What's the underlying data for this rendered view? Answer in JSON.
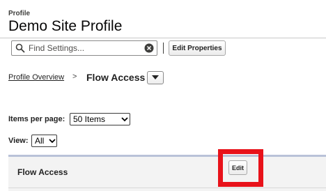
{
  "header": {
    "eyebrow": "Profile",
    "title": "Demo Site Profile"
  },
  "toolbar": {
    "search_placeholder": "Find Settings...",
    "edit_properties_label": "Edit Properties"
  },
  "breadcrumb": {
    "parent_label": "Profile Overview",
    "separator": ">",
    "current_label": "Flow Access"
  },
  "controls": {
    "items_per_page_label": "Items per page:",
    "items_per_page_value": "50 Items",
    "view_label": "View:",
    "view_value": "All"
  },
  "panel": {
    "title": "Flow Access",
    "edit_label": "Edit"
  },
  "colors": {
    "highlight": "#e8121a",
    "panel_bg": "#f3f3f3",
    "panel_border": "#b9c2d8"
  },
  "icons": {
    "search": "search-icon",
    "clear": "clear-icon",
    "dropdown": "chevron-down-icon"
  }
}
